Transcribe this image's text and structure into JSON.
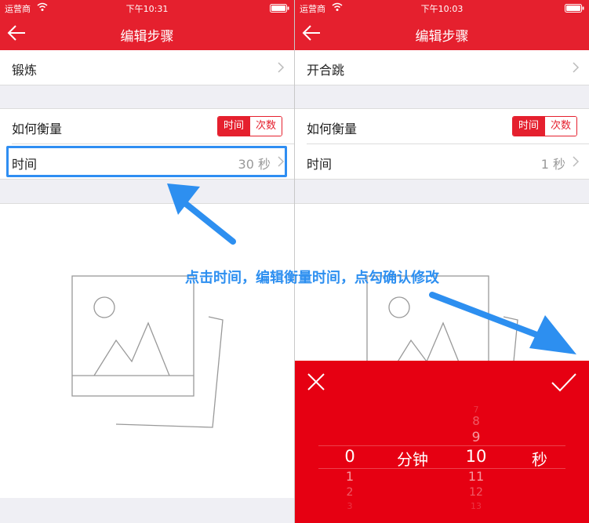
{
  "colors": {
    "brand_red": "#e5202e",
    "picker_red": "#e60012",
    "annotation_blue": "#2d8ff0"
  },
  "left_phone": {
    "status": {
      "carrier": "运营商",
      "time": "下午10:31"
    },
    "nav": {
      "title": "编辑步骤",
      "back_icon": "back-arrow-icon"
    },
    "exercise_name": "锻炼",
    "measure_label": "如何衡量",
    "segments": [
      "时间",
      "次数"
    ],
    "selected_segment": "时间",
    "time_label": "时间",
    "time_value": "30 秒"
  },
  "right_phone": {
    "status": {
      "carrier": "运营商",
      "time": "下午10:03"
    },
    "nav": {
      "title": "编辑步骤",
      "back_icon": "back-arrow-icon"
    },
    "exercise_name": "开合跳",
    "measure_label": "如何衡量",
    "segments": [
      "时间",
      "次数"
    ],
    "selected_segment": "时间",
    "time_label": "时间",
    "time_value": "1 秒",
    "picker": {
      "close_icon": "close-icon",
      "confirm_icon": "checkmark-icon",
      "minutes_selected": "0",
      "minutes_below": [
        "1",
        "2",
        "3"
      ],
      "minutes_unit": "分钟",
      "seconds_above": [
        "7",
        "8",
        "9"
      ],
      "seconds_selected": "10",
      "seconds_below": [
        "11",
        "12",
        "13"
      ],
      "seconds_unit": "秒"
    }
  },
  "annotation": {
    "text": "点击时间，编辑衡量时间，点勾确认修改"
  }
}
